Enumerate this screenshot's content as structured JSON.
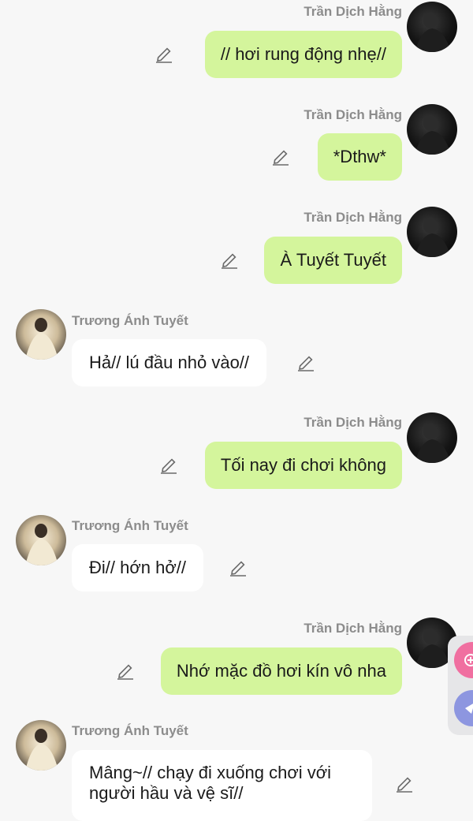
{
  "users": {
    "me": "Trần Dịch Hằng",
    "other": "Trương Ánh Tuyết"
  },
  "messages": [
    {
      "sender": "Trần Dịch Hằng",
      "text": "// hơi rung động nhẹ//"
    },
    {
      "sender": "Trần Dịch Hằng",
      "text": "*Dthw*"
    },
    {
      "sender": "Trần Dịch Hằng",
      "text": "À Tuyết Tuyết"
    },
    {
      "sender": "Trương Ánh Tuyết",
      "text": "Hả// lú đầu nhỏ vào//"
    },
    {
      "sender": "Trần Dịch Hằng",
      "text": "Tối nay đi chơi không"
    },
    {
      "sender": "Trương Ánh Tuyết",
      "text": "Đi// hớn hở//"
    },
    {
      "sender": "Trần Dịch Hằng",
      "text": "Nhớ mặc đồ hơi kín vô nha"
    },
    {
      "sender": "Trương Ánh Tuyết",
      "text": "Mâng~// chạy đi xuống chơi với người hầu và vệ sĩ//"
    }
  ],
  "icons": {
    "edit": "pencil-icon",
    "fab_top": "add-circle-icon",
    "fab_bottom": "send-icon"
  },
  "colors": {
    "background": "#f7f7f7",
    "my_bubble": "#d4f59c",
    "their_bubble": "#ffffff",
    "name_text": "#8c8c8c",
    "fab_pink": "#f06fa0",
    "fab_blue": "#8d96e0"
  }
}
